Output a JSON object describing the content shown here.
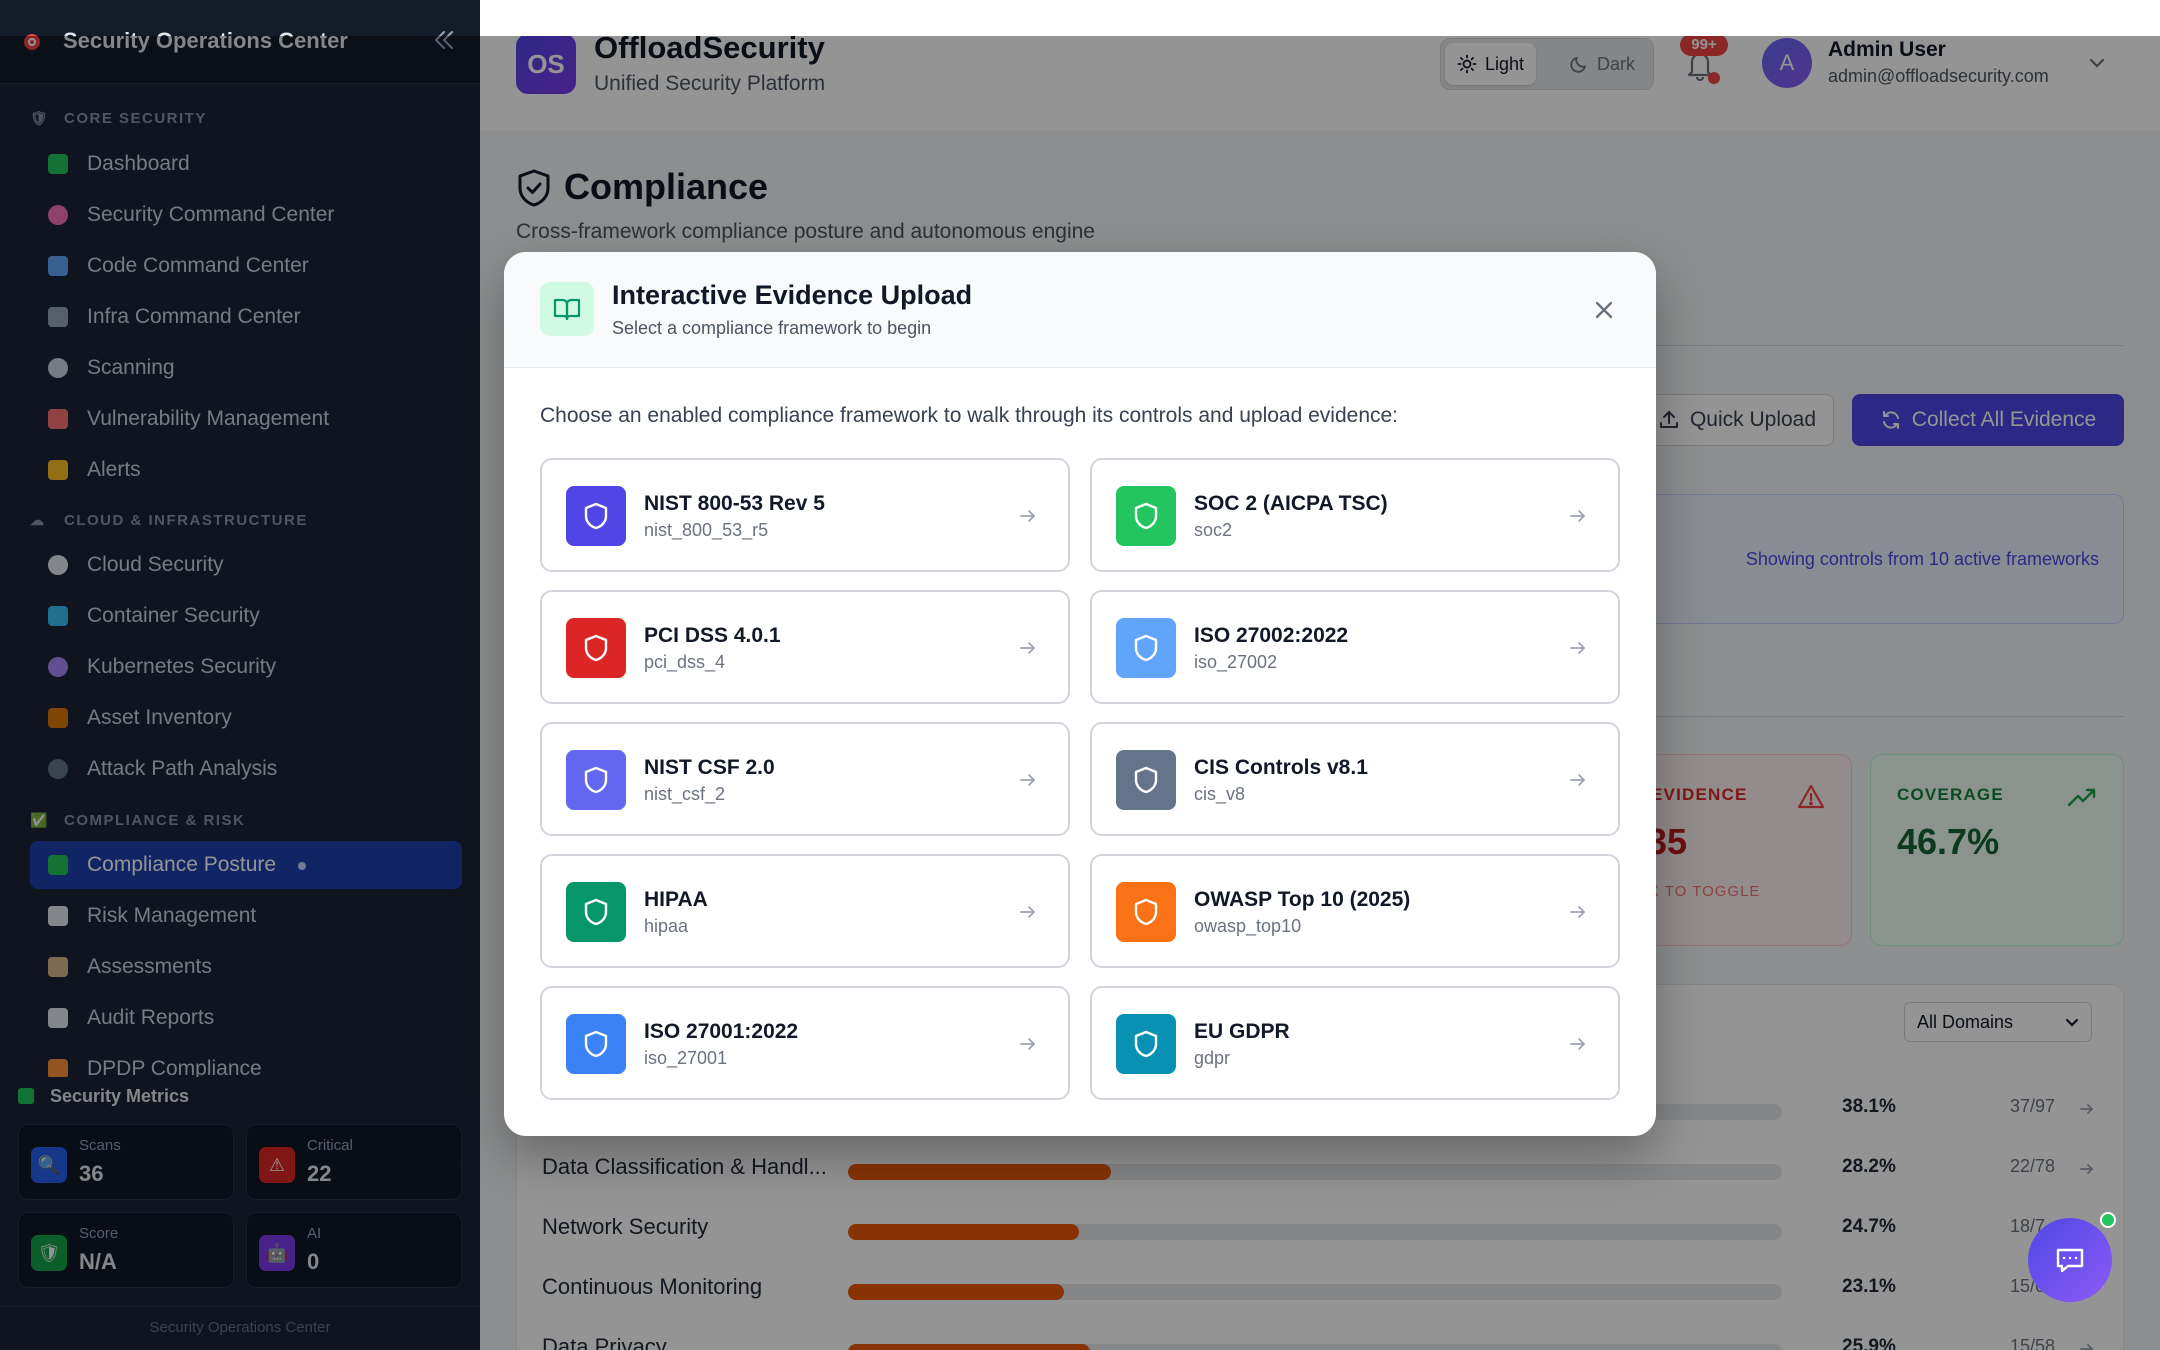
{
  "sidebar": {
    "title": "Security Operations Center",
    "sections": [
      {
        "label": "CORE SECURITY",
        "emoji": "🛡"
      },
      {
        "label": "CLOUD & INFRASTRUCTURE",
        "emoji": "☁"
      },
      {
        "label": "COMPLIANCE & RISK",
        "emoji": "✅"
      }
    ],
    "items": [
      {
        "label": "Dashboard",
        "icon": "chart-icon",
        "color": "#22c55e"
      },
      {
        "label": "Security Command Center",
        "icon": "brain-icon",
        "color": "#f472b6"
      },
      {
        "label": "Code Command Center",
        "icon": "dna-icon",
        "color": "#60a5fa"
      },
      {
        "label": "Infra Command Center",
        "icon": "monitor-icon",
        "color": "#94a3b8"
      },
      {
        "label": "Scanning",
        "icon": "magnifier-icon",
        "color": "#cbd5e1"
      },
      {
        "label": "Vulnerability Management",
        "icon": "shield-icon",
        "color": "#f87171"
      },
      {
        "label": "Alerts",
        "icon": "bell-icon",
        "color": "#fbbf24"
      },
      {
        "label": "Cloud Security",
        "icon": "cloud-icon",
        "color": "#e2e8f0"
      },
      {
        "label": "Container Security",
        "icon": "whale-icon",
        "color": "#38bdf8"
      },
      {
        "label": "Kubernetes Security",
        "icon": "helm-icon",
        "color": "#a78bfa"
      },
      {
        "label": "Asset Inventory",
        "icon": "package-icon",
        "color": "#d97706"
      },
      {
        "label": "Attack Path Analysis",
        "icon": "network-icon",
        "color": "#64748b"
      },
      {
        "label": "Compliance Posture",
        "icon": "check-icon",
        "color": "#22c55e",
        "active": true
      },
      {
        "label": "Risk Management",
        "icon": "trend-icon",
        "color": "#e2e8f0"
      },
      {
        "label": "Assessments",
        "icon": "clipboard-icon",
        "color": "#d6b98a"
      },
      {
        "label": "Audit Reports",
        "icon": "document-icon",
        "color": "#e2e8f0"
      },
      {
        "label": "DPDP Compliance",
        "icon": "flag-icon",
        "color": "#fb923c"
      }
    ],
    "metrics": {
      "title": "Security Metrics",
      "cards": [
        {
          "label": "Scans",
          "value": "36",
          "color": "#2563eb",
          "glyph": "🔍"
        },
        {
          "label": "Critical",
          "value": "22",
          "color": "#dc2626",
          "glyph": "⚠"
        },
        {
          "label": "Score",
          "value": "N/A",
          "color": "#16a34a",
          "glyph": "🛡"
        },
        {
          "label": "AI",
          "value": "0",
          "color": "#7c3aed",
          "glyph": "🤖"
        }
      ]
    },
    "footer": "Security Operations Center"
  },
  "header": {
    "badge": "OS",
    "brand": "OffloadSecurity",
    "tagline": "Unified Security Platform",
    "theme_light": "Light",
    "theme_dark": "Dark",
    "notifications": "99+",
    "user_initial": "A",
    "user_name": "Admin User",
    "user_email": "admin@offloadsecurity.com"
  },
  "page": {
    "title": "Compliance",
    "subtitle": "Cross-framework compliance posture and autonomous engine",
    "quick_upload": "Quick Upload",
    "collect_all": "Collect All Evidence",
    "banner": "Showing controls from 10 active frameworks",
    "evidence_label": "EVIDENCE",
    "evidence_value": "35",
    "evidence_hint": "CK TO TOGGLE",
    "coverage_label": "COVERAGE",
    "coverage_value": "46.7%",
    "domain_filter": "All Domains",
    "domains": [
      {
        "name": "",
        "pct": "38.1%",
        "count": "37/97",
        "value": 38.1
      },
      {
        "name": "Data Classification & Handl...",
        "pct": "28.2%",
        "count": "22/78",
        "value": 28.2
      },
      {
        "name": "Network Security",
        "pct": "24.7%",
        "count": "18/7",
        "value": 24.7
      },
      {
        "name": "Continuous Monitoring",
        "pct": "23.1%",
        "count": "15/6",
        "value": 23.1
      },
      {
        "name": "Data Privacy",
        "pct": "25.9%",
        "count": "15/58",
        "value": 25.9
      }
    ]
  },
  "modal": {
    "title": "Interactive Evidence Upload",
    "subtitle": "Select a compliance framework to begin",
    "prompt": "Choose an enabled compliance framework to walk through its controls and upload evidence:",
    "frameworks": [
      {
        "name": "NIST 800-53 Rev 5",
        "code": "nist_800_53_r5",
        "color": "#4f46e5"
      },
      {
        "name": "SOC 2 (AICPA TSC)",
        "code": "soc2",
        "color": "#22c55e"
      },
      {
        "name": "PCI DSS 4.0.1",
        "code": "pci_dss_4",
        "color": "#dc2626"
      },
      {
        "name": "ISO 27002:2022",
        "code": "iso_27002",
        "color": "#60a5fa"
      },
      {
        "name": "NIST CSF 2.0",
        "code": "nist_csf_2",
        "color": "#6366f1"
      },
      {
        "name": "CIS Controls v8.1",
        "code": "cis_v8",
        "color": "#64748b"
      },
      {
        "name": "HIPAA",
        "code": "hipaa",
        "color": "#059669"
      },
      {
        "name": "OWASP Top 10 (2025)",
        "code": "owasp_top10",
        "color": "#f97316"
      },
      {
        "name": "ISO 27001:2022",
        "code": "iso_27001",
        "color": "#3b82f6"
      },
      {
        "name": "EU GDPR",
        "code": "gdpr",
        "color": "#0891b2"
      }
    ]
  }
}
